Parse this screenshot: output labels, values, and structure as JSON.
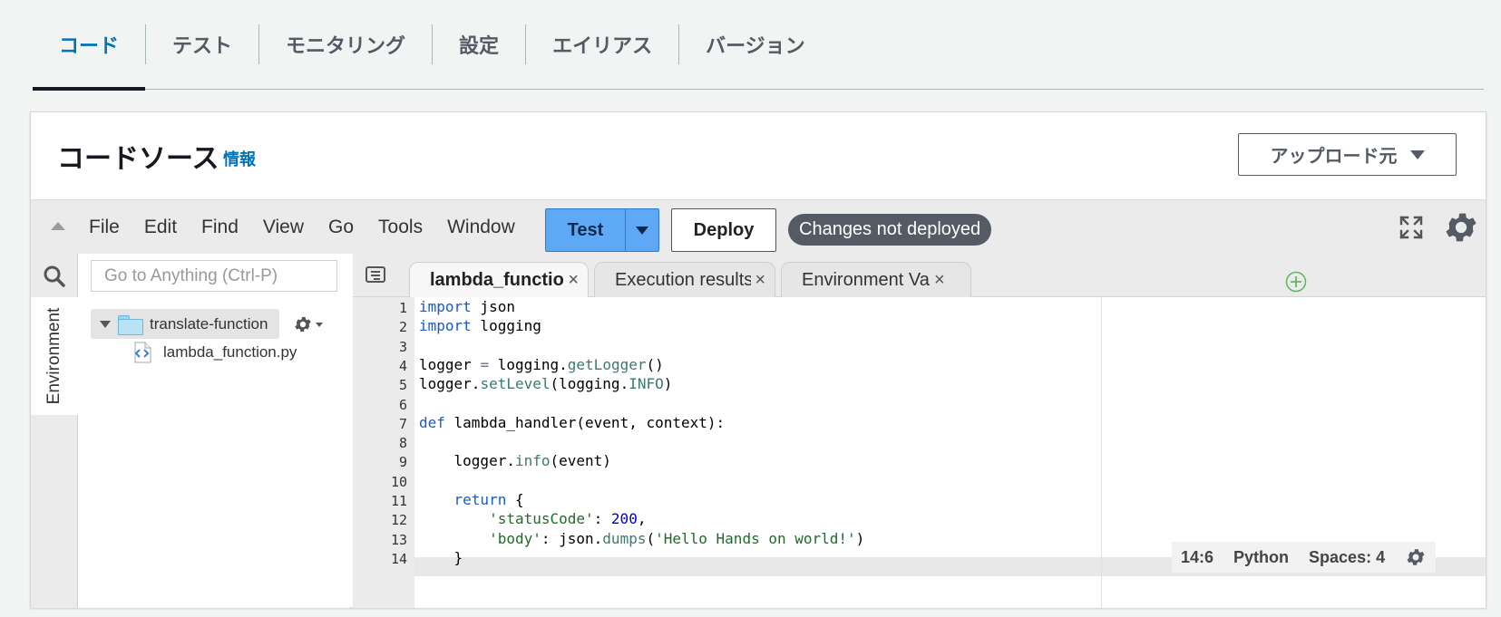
{
  "top_tabs": [
    {
      "label": "コード",
      "active": true
    },
    {
      "label": "テスト"
    },
    {
      "label": "モニタリング"
    },
    {
      "label": "設定"
    },
    {
      "label": "エイリアス"
    },
    {
      "label": "バージョン"
    }
  ],
  "panel": {
    "title": "コードソース",
    "info_link": "情報",
    "upload_button": "アップロード元"
  },
  "toolbar": {
    "menu": [
      "File",
      "Edit",
      "Find",
      "View",
      "Go",
      "Tools",
      "Window"
    ],
    "test_label": "Test",
    "deploy_label": "Deploy",
    "status": "Changes not deployed"
  },
  "sidebar": {
    "env_tab": "Environment",
    "goto_placeholder": "Go to Anything (Ctrl-P)",
    "root_folder": "translate-function",
    "files": [
      "lambda_function.py"
    ]
  },
  "editor_tabs": [
    {
      "label": "lambda_function",
      "active": true
    },
    {
      "label": "Execution results"
    },
    {
      "label": "Environment Vari"
    }
  ],
  "code": {
    "language": "Python",
    "lines": [
      "import json",
      "import logging",
      "",
      "logger = logging.getLogger()",
      "logger.setLevel(logging.INFO)",
      "",
      "def lambda_handler(event, context):",
      "",
      "    logger.info(event)",
      "",
      "    return {",
      "        'statusCode': 200,",
      "        'body': json.dumps('Hello Hands on world!')",
      "    }"
    ]
  },
  "status_bar": {
    "cursor": "14:6",
    "language": "Python",
    "spaces": "Spaces: 4"
  },
  "colors": {
    "accent": "#0073bb",
    "test_button": "#5fa8f5",
    "status_pill": "#545b64"
  }
}
